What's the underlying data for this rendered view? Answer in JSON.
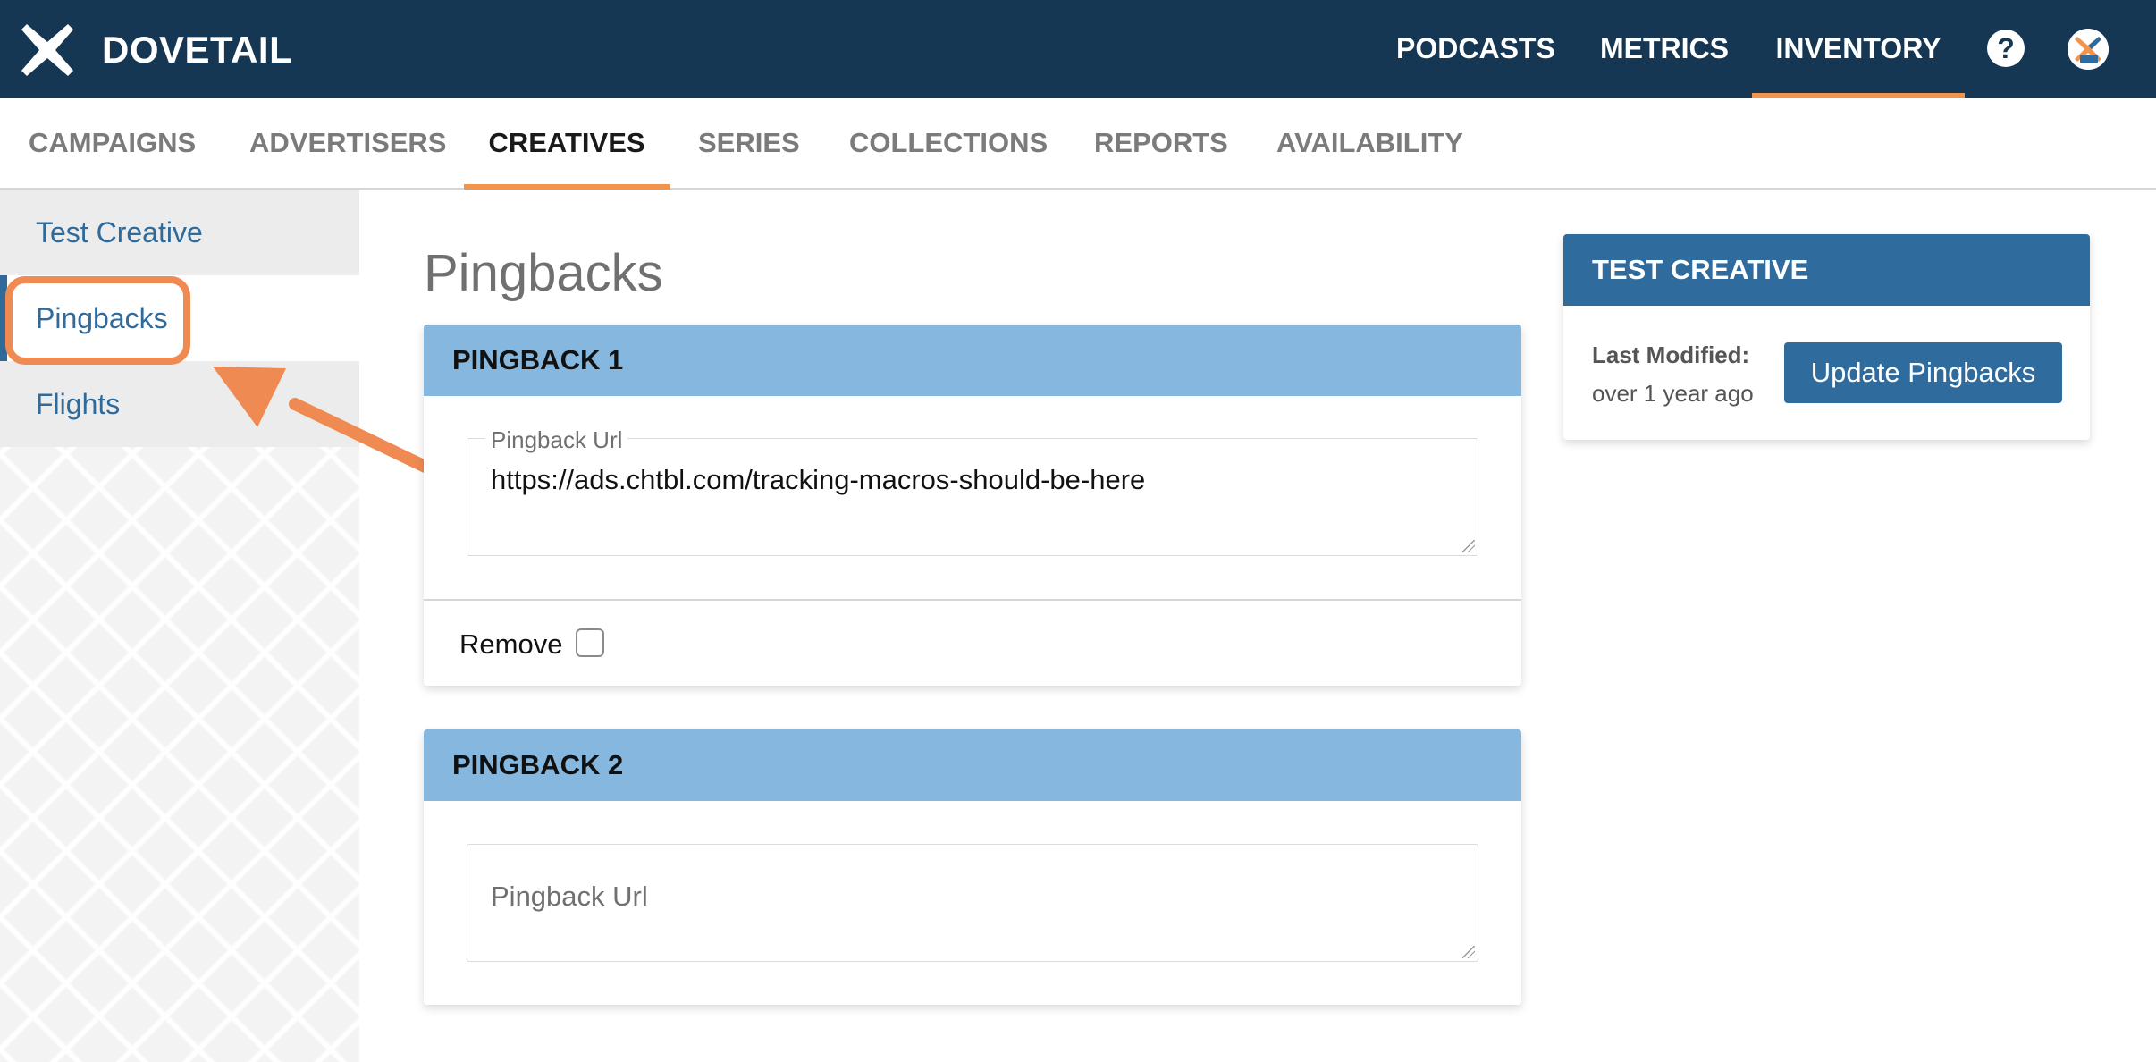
{
  "brand": {
    "name": "DOVETAIL"
  },
  "topnav": {
    "items": [
      {
        "label": "PODCASTS",
        "active": false
      },
      {
        "label": "METRICS",
        "active": false
      },
      {
        "label": "INVENTORY",
        "active": true
      }
    ],
    "help_icon": "question-circle-icon",
    "help_glyph": "?",
    "avatar": "prx-avatar"
  },
  "subnav": {
    "items": [
      {
        "label": "CAMPAIGNS",
        "active": false
      },
      {
        "label": "ADVERTISERS",
        "active": false
      },
      {
        "label": "CREATIVES",
        "active": true
      },
      {
        "label": "SERIES",
        "active": false
      },
      {
        "label": "COLLECTIONS",
        "active": false
      },
      {
        "label": "REPORTS",
        "active": false
      },
      {
        "label": "AVAILABILITY",
        "active": false
      }
    ]
  },
  "sidebar": {
    "items": [
      {
        "label": "Test Creative",
        "active": false
      },
      {
        "label": "Pingbacks",
        "active": true
      },
      {
        "label": "Flights",
        "active": false
      }
    ]
  },
  "main": {
    "title": "Pingbacks",
    "pingbacks": [
      {
        "header": "PINGBACK 1",
        "url_label": "Pingback Url",
        "url_value": "https://ads.chtbl.com/tracking-macros-should-be-here",
        "remove_label": "Remove",
        "remove_checked": false
      },
      {
        "header": "PINGBACK 2",
        "url_placeholder": "Pingback Url",
        "url_value": ""
      }
    ]
  },
  "panel": {
    "header": "TEST CREATIVE",
    "last_modified_label": "Last Modified:",
    "last_modified_value": "over 1 year ago",
    "update_button": "Update Pingbacks"
  },
  "annotation": {
    "highlight_color": "#ef8a52",
    "arrow_color": "#ef8a52"
  },
  "colors": {
    "topbar": "#163754",
    "accent": "#f0944e",
    "link": "#2f6a9b",
    "card_header": "#86b7de",
    "primary": "#2f6b9d"
  }
}
